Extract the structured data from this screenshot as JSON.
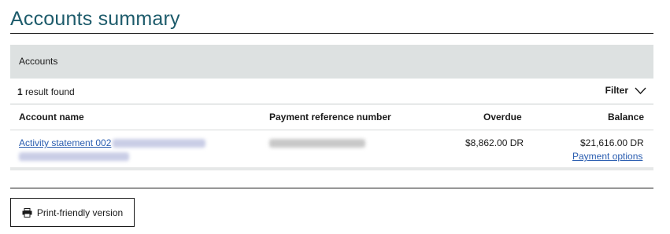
{
  "page": {
    "title": "Accounts summary"
  },
  "accounts_section": {
    "header": "Accounts"
  },
  "results": {
    "count": "1",
    "suffix": " result found"
  },
  "filter": {
    "label": "Filter",
    "icon": "chevron-down-icon"
  },
  "table": {
    "columns": [
      "Account name",
      "Payment reference number",
      "Overdue",
      "Balance"
    ],
    "rows": [
      {
        "account_name_link": "Activity statement 002",
        "overdue": "$8,862.00 DR",
        "balance": "$21,616.00 DR",
        "payment_options_link": "Payment options"
      }
    ]
  },
  "print": {
    "label": "Print-friendly version",
    "icon": "printer-icon"
  },
  "colors": {
    "title": "#1d5b6b",
    "link": "#2a5db0",
    "header_bg": "#dde1e1"
  }
}
